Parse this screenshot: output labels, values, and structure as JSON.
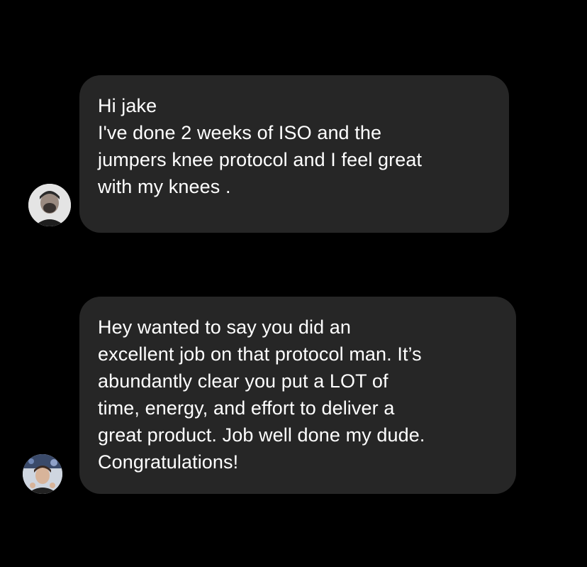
{
  "theme": {
    "background": "#000000",
    "bubble_color": "#262626",
    "text_color": "#ffffff"
  },
  "messages": [
    {
      "avatar_icon": "user-avatar-icon",
      "lines": [
        "Hi jake",
        "I've done 2 weeks of ISO and the",
        "jumpers knee protocol and I feel great",
        "with my knees ."
      ]
    },
    {
      "avatar_icon": "user-avatar-icon",
      "lines": [
        "Hey wanted to say you did an",
        "excellent job on that protocol man. It’s",
        "abundantly clear you put a LOT of",
        "time, energy, and effort to deliver a",
        "great product. Job well done my dude.",
        "Congratulations!"
      ]
    }
  ]
}
